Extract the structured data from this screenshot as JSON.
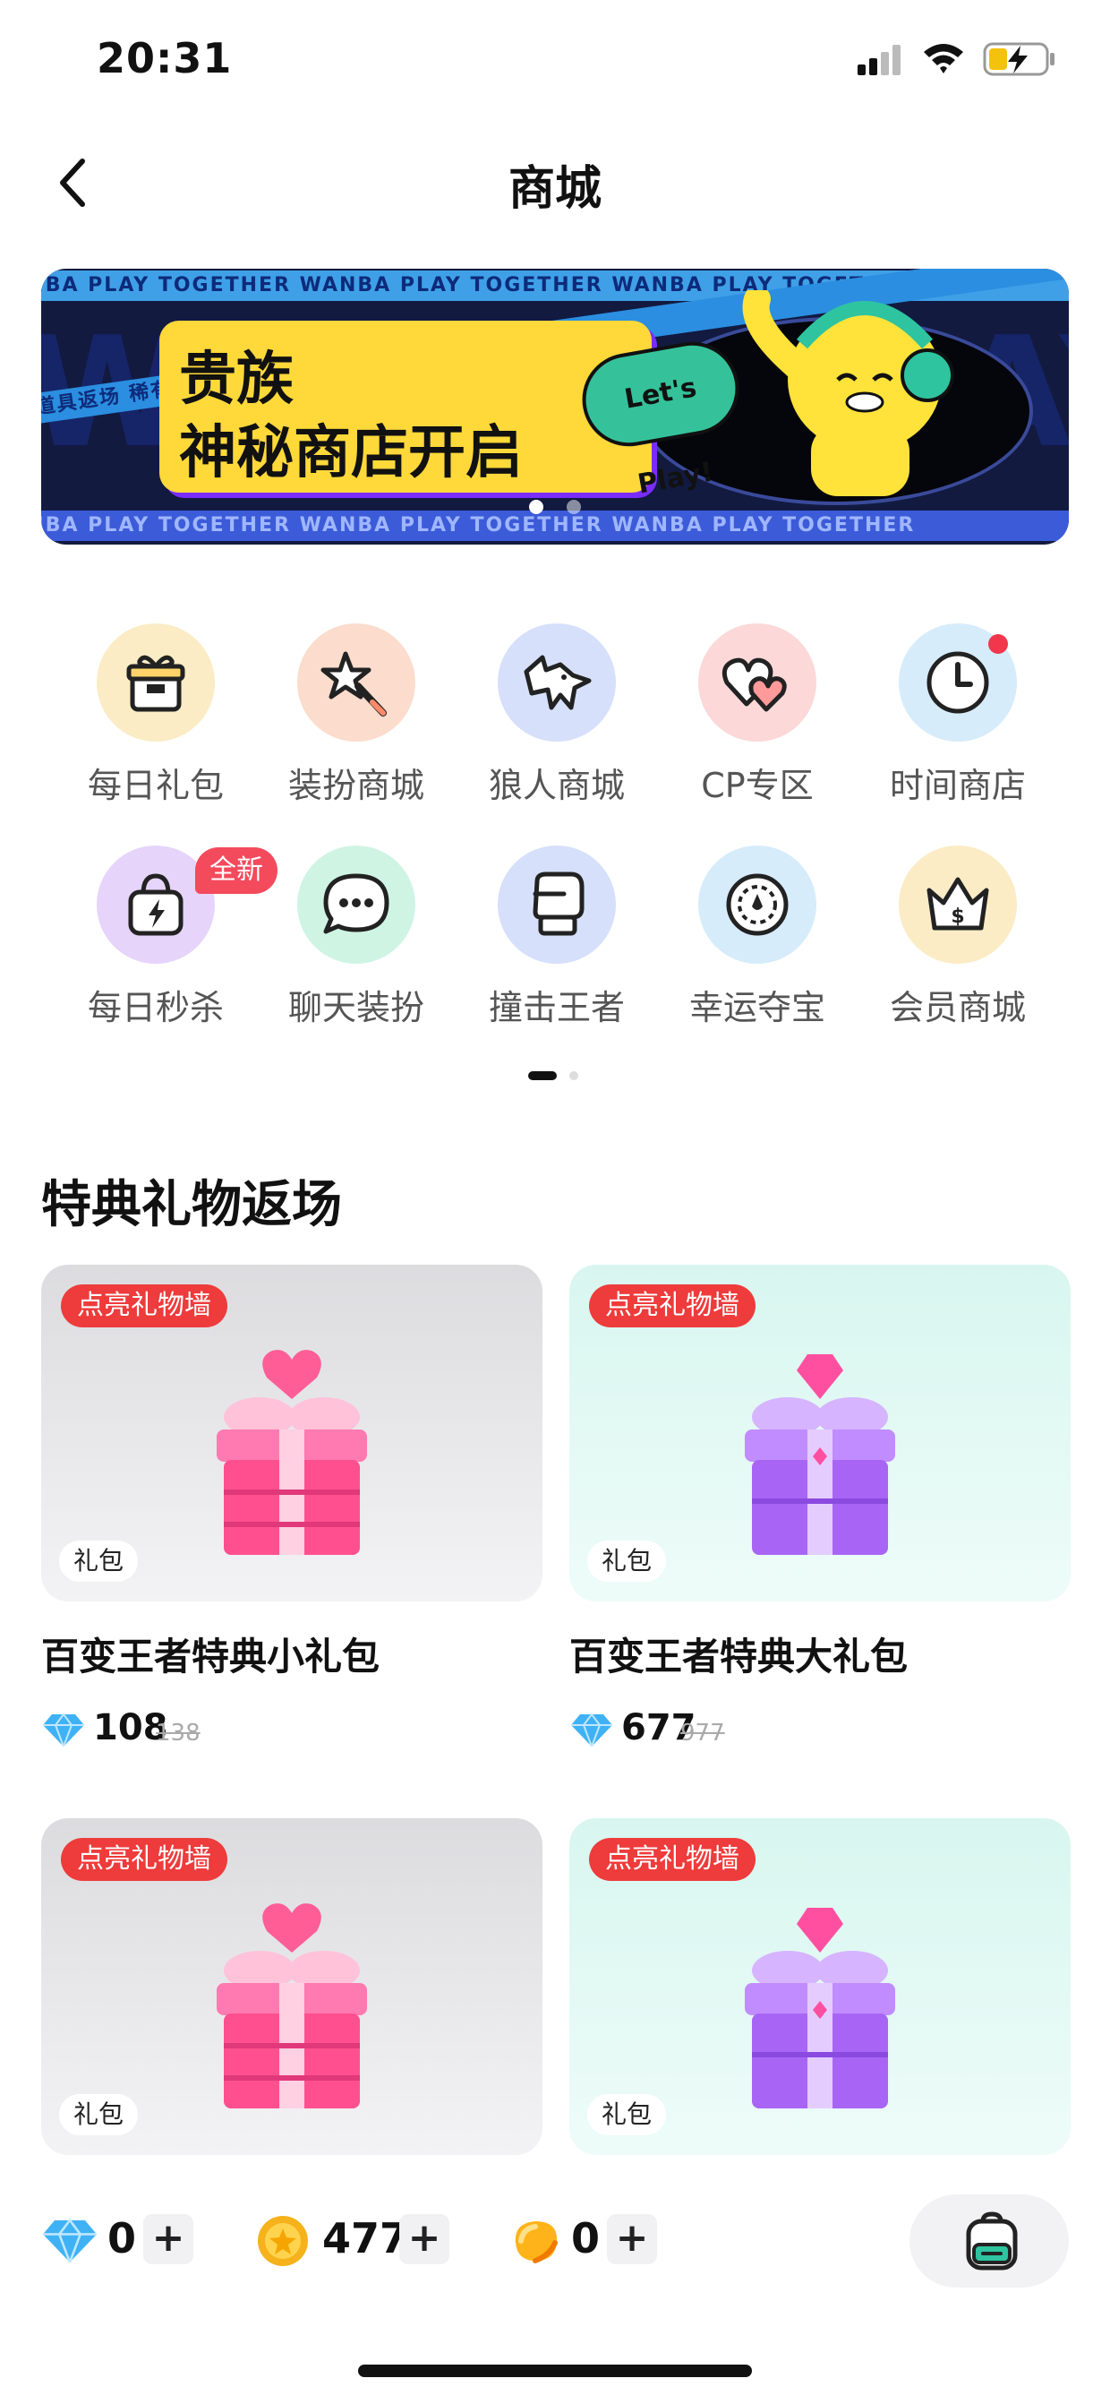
{
  "status": {
    "time": "20:31"
  },
  "nav": {
    "title": "商城"
  },
  "banner": {
    "band_text": "WANBA PLAY TOGETHER WANBA PLAY TOGETHER WANBA PLAY TOGETHER",
    "band_text_cn": "稀有道具返场 稀有道具返场 稀有道具返场",
    "line1": "贵族",
    "line2": "神秘商店开启",
    "badge": "Let's Play!",
    "active_slide": 1,
    "slides": 2
  },
  "categories": [
    {
      "label": "每日礼包",
      "icon": "gift-box-icon"
    },
    {
      "label": "装扮商城",
      "icon": "magic-wand-icon"
    },
    {
      "label": "狼人商城",
      "icon": "wolf-icon"
    },
    {
      "label": "CP专区",
      "icon": "hearts-icon"
    },
    {
      "label": "时间商店",
      "icon": "clock-icon"
    },
    {
      "label": "每日秒杀",
      "icon": "flash-bag-icon"
    },
    {
      "label": "聊天装扮",
      "icon": "chat-bubble-icon"
    },
    {
      "label": "撞击王者",
      "icon": "boxing-glove-icon"
    },
    {
      "label": "幸运夺宝",
      "icon": "lucky-wheel-icon"
    },
    {
      "label": "会员商城",
      "icon": "crown-icon"
    }
  ],
  "new_tag": "全新",
  "section_title": "特典礼物返场",
  "products": [
    {
      "tag": "点亮礼物墙",
      "kind": "礼包",
      "name": "百变王者特典小礼包",
      "price": "108",
      "original_price": "138",
      "gift": "pink-heart-gift-icon"
    },
    {
      "tag": "点亮礼物墙",
      "kind": "礼包",
      "name": "百变王者特典大礼包",
      "price": "677",
      "original_price": "977",
      "gift": "purple-diamond-gift-icon"
    },
    {
      "tag": "点亮礼物墙",
      "kind": "礼包",
      "gift": "pink-heart-gift-icon"
    },
    {
      "tag": "点亮礼物墙",
      "kind": "礼包",
      "gift": "purple-diamond-gift-icon"
    }
  ],
  "wallet": {
    "diamonds": "0",
    "coins": "477",
    "beans": "0",
    "plus_label": "+"
  }
}
